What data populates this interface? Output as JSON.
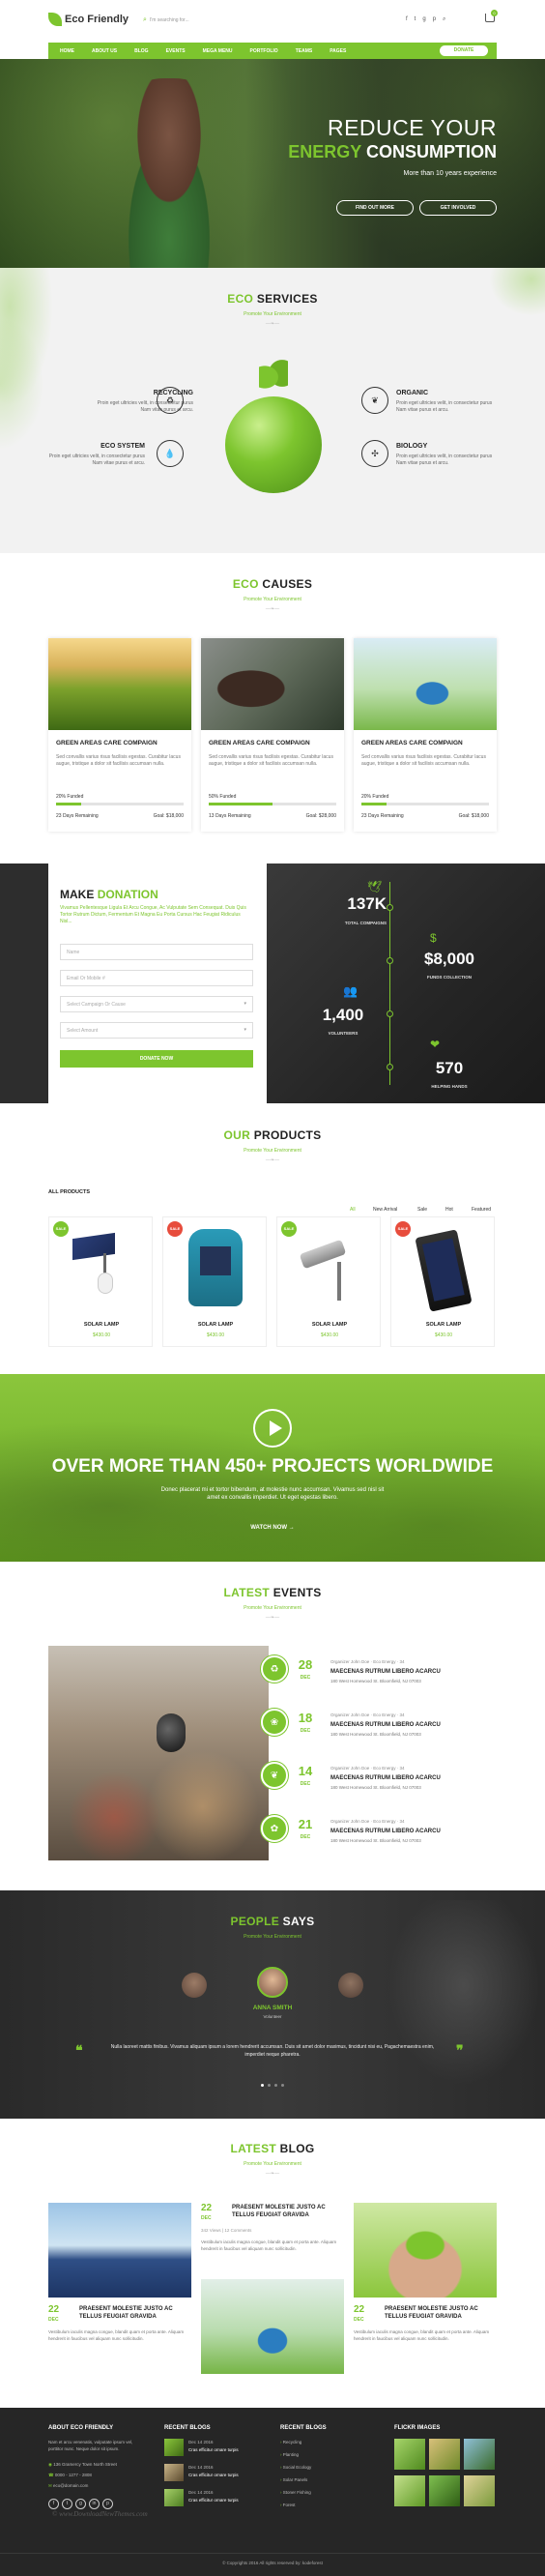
{
  "brand": {
    "name": "Eco Friendly",
    "accent": "#7dc52e",
    "dark": "#2b2b2b"
  },
  "header": {
    "search_placeholder": "I'm searching for...",
    "social_icons": [
      "facebook-icon",
      "twitter-icon",
      "google-plus-icon",
      "pinterest-icon",
      "search-icon"
    ],
    "cart_count": "0"
  },
  "nav": {
    "items": [
      "HOME",
      "ABOUT US",
      "BLOG",
      "EVENTS",
      "MEGA MENU",
      "PORTFOLIO",
      "TEAMS",
      "PAGES"
    ],
    "donate": "DONATE"
  },
  "hero": {
    "line1": "REDUCE YOUR",
    "line2_green": "ENERGY",
    "line2_white": "CONSUMPTION",
    "sub": "More than 10 years experience",
    "btn1": "FIND OUT MORE",
    "btn2": "GET INVOLVED"
  },
  "services": {
    "title_green": "ECO",
    "title_dark": "SERVICES",
    "sub": "Promote Your Environment",
    "items": [
      {
        "title": "RECYCLING",
        "text": "Proin eget ultricies velit, in consectetur purus Nam vitae purus et arcu.",
        "icon": "recycle-icon"
      },
      {
        "title": "ECO SYSTEM",
        "text": "Proin eget ultricies velit, in consectetur purus Nam vitae purus et arcu.",
        "icon": "water-drop-icon"
      },
      {
        "title": "ORGANIC",
        "text": "Proin eget ultricies velit, in consectetur purus Nam vitae purus et arcu.",
        "icon": "leaf-icon"
      },
      {
        "title": "BIOLOGY",
        "text": "Proin eget ultricies velit, in consectetur purus Nam vitae purus et arcu.",
        "icon": "molecule-icon"
      }
    ]
  },
  "causes": {
    "title_green": "ECO",
    "title_dark": "CAUSES",
    "sub": "Promote Your Environment",
    "cards": [
      {
        "title": "GREEN AREAS CARE COMPAIGN",
        "text": "Sed convallis varius risus facilisis egestas. Curabitur lacus augue, tristique a dolor sit facilisis accumsan nulla.",
        "funded": "20% Funded",
        "progress": 0.2,
        "days": "23 Days Remaining",
        "goal": "Goal: $18,000"
      },
      {
        "title": "GREEN AREAS CARE COMPAIGN",
        "text": "Sed convallis varius risus facilisis egestas. Curabitur lacus augue, tristique a dolor sit facilisis accumsan nulla.",
        "funded": "50% Funded",
        "progress": 0.5,
        "days": "13 Days Remaining",
        "goal": "Goal: $28,000"
      },
      {
        "title": "GREEN AREAS CARE COMPAIGN",
        "text": "Sed convallis varius risus facilisis egestas. Curabitur lacus augue, tristique a dolor sit facilisis accumsan nulla.",
        "funded": "20% Funded",
        "progress": 0.2,
        "days": "23 Days Remaining",
        "goal": "Goal: $18,000"
      }
    ]
  },
  "donation": {
    "title_dark": "MAKE",
    "title_green": "DONATION",
    "text": "Vivamus Pellentesque Ligula Et Arcu Congue, Ac Vulputate Sem Consequat. Duis Quis Tortor Rutrum Dictum, Fermentum Et Magna Eu Porta Cursus Hac Feugiat Ridiculus Nisl...",
    "fields": [
      "Name",
      "Email Or Mobile #",
      "Select Campaign Or Cause",
      "Select Amount"
    ],
    "button": "DONATE NOW",
    "stats": [
      {
        "num": "137K",
        "label": "TOTAL COMPAIGNS",
        "icon": "bird-icon"
      },
      {
        "num": "$8,000",
        "label": "FUNDS COLLECTION",
        "icon": "hand-money-icon"
      },
      {
        "num": "1,400",
        "label": "VOLUNTEERS",
        "icon": "people-icon"
      },
      {
        "num": "570",
        "label": "HELPING HANDS",
        "icon": "hand-heart-icon"
      }
    ]
  },
  "products": {
    "title_green": "OUR",
    "title_dark": "PRODUCTS",
    "sub": "Promote Your Environment",
    "all_label": "ALL PRODUCTS",
    "filters": [
      "All",
      "New Arrival",
      "Sale",
      "Hot",
      "Featured"
    ],
    "items": [
      {
        "name": "SOLAR LAMP",
        "price": "$430.00",
        "badge": "SALE",
        "badge_color": "#7dc52e"
      },
      {
        "name": "SOLAR LAMP",
        "price": "$430.00",
        "badge": "SALE",
        "badge_color": "#e74c3c"
      },
      {
        "name": "SOLAR LAMP",
        "price": "$430.00",
        "badge": "SALE",
        "badge_color": "#7dc52e"
      },
      {
        "name": "SOLAR LAMP",
        "price": "$430.00",
        "badge": "SALE",
        "badge_color": "#e74c3c"
      }
    ]
  },
  "projects": {
    "title": "OVER MORE THAN 450+ PROJECTS WORLDWIDE",
    "text": "Donec placerat mi et tortor bibendum, at molestie nunc accumsan. Vivamus sed nisl sit amet ex convallis imperdiet. Ut eget egestas libero.",
    "link": "WATCH NOW"
  },
  "events": {
    "title_green": "LATEST",
    "title_dark": "EVENTS",
    "sub": "Promote Your Environment",
    "items": [
      {
        "day": "28",
        "mon": "DEC",
        "meta": "Organizer  John Doe  ·  Eco Energy  ·  34",
        "title": "MAECENAS RUTRUM LIBERO ACARCU",
        "addr": "180 West Homewood St. Bloomfield, NJ 07003",
        "icon": "recycle-icon"
      },
      {
        "day": "18",
        "mon": "DEC",
        "meta": "Organizer  John Doe  ·  Eco Energy  ·  34",
        "title": "MAECENAS RUTRUM LIBERO ACARCU",
        "addr": "180 West Homewood St. Bloomfield, NJ 07003",
        "icon": "plant-icon"
      },
      {
        "day": "14",
        "mon": "DEC",
        "meta": "Organizer  John Doe  ·  Eco Energy  ·  34",
        "title": "MAECENAS RUTRUM LIBERO ACARCU",
        "addr": "180 West Homewood St. Bloomfield, NJ 07003",
        "icon": "leaf-icon"
      },
      {
        "day": "21",
        "mon": "DEC",
        "meta": "Organizer  John Doe  ·  Eco Energy  ·  34",
        "title": "MAECENAS RUTRUM LIBERO ACARCU",
        "addr": "180 West Homewood St. Bloomfield, NJ 07003",
        "icon": "hand-plant-icon"
      }
    ]
  },
  "testimonials": {
    "title_green": "PEOPLE",
    "title_dark": "SAYS",
    "sub": "Promote Your Environment",
    "name": "ANNA SMITH",
    "role": "Volunteer",
    "quote": "Nulla laoreet mattis finibus. Vivamus aliquam ipsum a lorem hendrerit accumsan. Duis sit amet dolor maximus, tincidunt nisi eu, Pagachemaestra enim, imperdiet neque pharetra."
  },
  "blog": {
    "title_green": "LATEST",
    "title_dark": "BLOG",
    "sub": "Promote Your Environment",
    "posts": [
      {
        "day": "22",
        "mon": "DEC",
        "title": "PRAESENT MOLESTIE JUSTO AC TELLUS FEUGIAT GRAVIDA",
        "meta": "342 Views  |  12 Comments",
        "text": "Vestibulum iaculis magna congue, blandit quam et porta ante. Aliquam hendrerit in faucibus vel aliquam nunc sollicitudin."
      },
      {
        "day": "22",
        "mon": "DEC",
        "title": "PRAESENT MOLESTIE JUSTO AC TELLUS FEUGIAT GRAVIDA",
        "meta": "342 Views  |  12 Comments",
        "text": "Vestibulum iaculis magna congue, blandit quam et porta ante. Aliquam hendrerit in faucibus vel aliquam nunc sollicitudin."
      },
      {
        "day": "22",
        "mon": "DEC",
        "title": "PRAESENT MOLESTIE JUSTO AC TELLUS FEUGIAT GRAVIDA",
        "meta": "342 Views  |  12 Comments",
        "text": "Vestibulum iaculis magna congue, blandit quam et porta ante. Aliquam hendrerit in faucibus vel aliquam nunc sollicitudin."
      }
    ]
  },
  "footer": {
    "about_title": "ABOUT ECO FRIENDLY",
    "about_text": "Nam et arcu venenatis, vulputate ipsum vel, porttitor nunc. Neque dolor sit ipsum.",
    "address": "136 Gramercy Town North Street",
    "phone": "0000 - 1277 - 2808",
    "email": "eco@domain.com",
    "recent_title": "RECENT BLOGS",
    "recent": [
      {
        "date": "Dec 14 2016",
        "title": "Cras efficitur ornare turpis"
      },
      {
        "date": "Dec 14 2016",
        "title": "Cras efficitur ornare turpis"
      },
      {
        "date": "Dec 14 2016",
        "title": "Cras efficitur ornare turpis"
      }
    ],
    "recent2_title": "RECENT BLOGS",
    "links": [
      "Recycling",
      "Planting",
      "Social Ecology",
      "Solar Panels",
      "Stoner Fishing",
      "Forest"
    ],
    "flickr_title": "FLICKR IMAGES",
    "copyright": "© Copyrights 2016 All rights reserved by: kodeforest",
    "watermark": "© www.DownloadNewThemes.com"
  }
}
